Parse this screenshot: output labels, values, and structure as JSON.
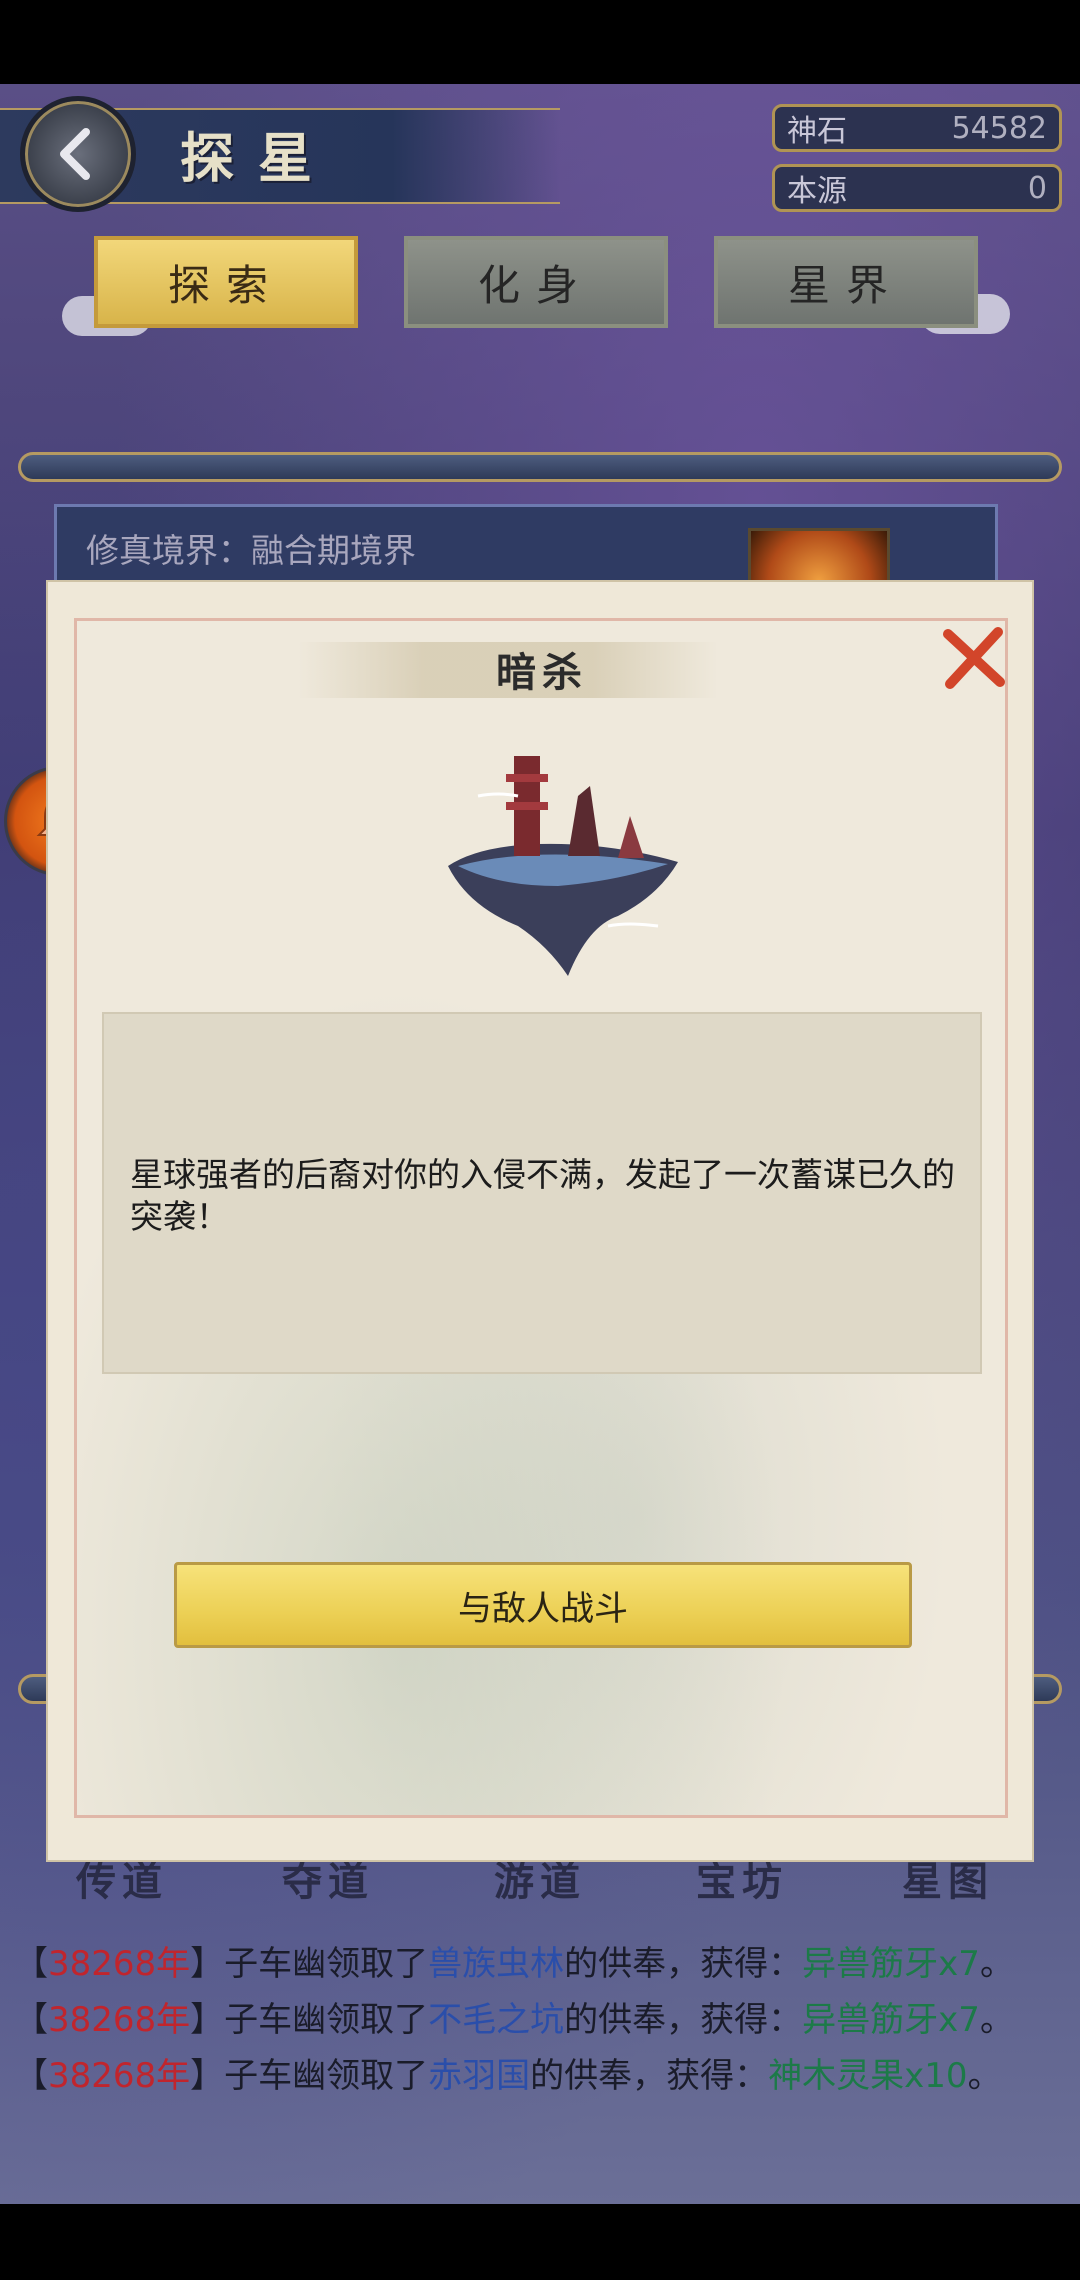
{
  "header": {
    "title": "探星",
    "back_icon": "back-arrow-icon",
    "resources": [
      {
        "label": "神石",
        "value": "54582"
      },
      {
        "label": "本源",
        "value": "0"
      }
    ]
  },
  "tabs": [
    {
      "label": "探索",
      "active": true
    },
    {
      "label": "化身",
      "active": false
    },
    {
      "label": "星界",
      "active": false
    }
  ],
  "info": {
    "realm": "修真境界：融合期境界"
  },
  "notification": {
    "icon": "bell-icon"
  },
  "modal": {
    "title": "暗杀",
    "close_icon": "close-icon",
    "event_text": "星球强者的后裔对你的入侵不满，发起了一次蓄谋已久的突袭！",
    "action_label": "与敌人战斗"
  },
  "bottom_tabs": [
    "传道",
    "夺道",
    "游道",
    "宝坊",
    "星图"
  ],
  "log": [
    {
      "pre": "【",
      "year": "38268年",
      "mid": "】子车幽领取了",
      "place": "兽族虫林",
      "post": "的供奉，获得：",
      "reward": "异兽筋牙x7",
      "end": "。"
    },
    {
      "pre": "【",
      "year": "38268年",
      "mid": "】子车幽领取了",
      "place": "不毛之坑",
      "post": "的供奉，获得：",
      "reward": "异兽筋牙x7",
      "end": "。"
    },
    {
      "pre": "【",
      "year": "38268年",
      "mid": "】子车幽领取了",
      "place": "赤羽国",
      "post": "的供奉，获得：",
      "reward": "神木灵果x10",
      "end": "。"
    }
  ],
  "colors": {
    "active_tab": "#f2d77a",
    "year": "#c0252d",
    "place": "#2a4eaa",
    "reward": "#1c7a48",
    "action_button": "#ecd055"
  }
}
